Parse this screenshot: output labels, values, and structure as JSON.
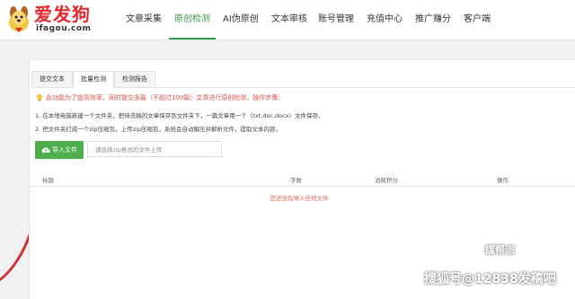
{
  "header": {
    "logo": {
      "title": "爱发狗",
      "subtitle": "ifagou.com"
    },
    "nav": [
      {
        "label": "文章采集",
        "active": false
      },
      {
        "label": "原创检测",
        "active": true
      },
      {
        "label": "AI伪原创",
        "active": false
      },
      {
        "label": "文本审核",
        "active": false
      },
      {
        "label": "账号管理",
        "active": false
      },
      {
        "label": "充值中心",
        "active": false
      },
      {
        "label": "推广赚分",
        "active": false
      },
      {
        "label": "客户端",
        "active": false
      }
    ]
  },
  "tabs": [
    {
      "label": "提交文本",
      "active": false
    },
    {
      "label": "批量检测",
      "active": true
    },
    {
      "label": "检测报告",
      "active": false
    }
  ],
  "notice": "此功能为了提高效率，同时提交多篇（不超过100篇）文章进行原创检测，操作步骤：",
  "steps": [
    "1. 在本地电脑新建一个文件夹，把待洗稿的文章保存到文件夹下，一篇文章用一个（txt,doc,docx）文件保存。",
    "2. 把文件夹打成一个zip压缩包，上传zip压缩包，系统会自动解压并解析文件，提取文本内容。"
  ],
  "upload": {
    "button_label": "导入文件",
    "placeholder": "请选择zip格式的文件上传"
  },
  "table": {
    "headers": [
      "标题",
      "字数",
      "消耗积分",
      "操作"
    ],
    "empty_text": "您还没有导入任何文件"
  },
  "watermark": {
    "brand": "媒帮派",
    "text": "搜狐号@12838发稿吧"
  },
  "colors": {
    "accent": "#3a9a4e",
    "logo_red": "#e8262d",
    "notice_red": "#d9534f",
    "button_green": "#4cae4c"
  }
}
